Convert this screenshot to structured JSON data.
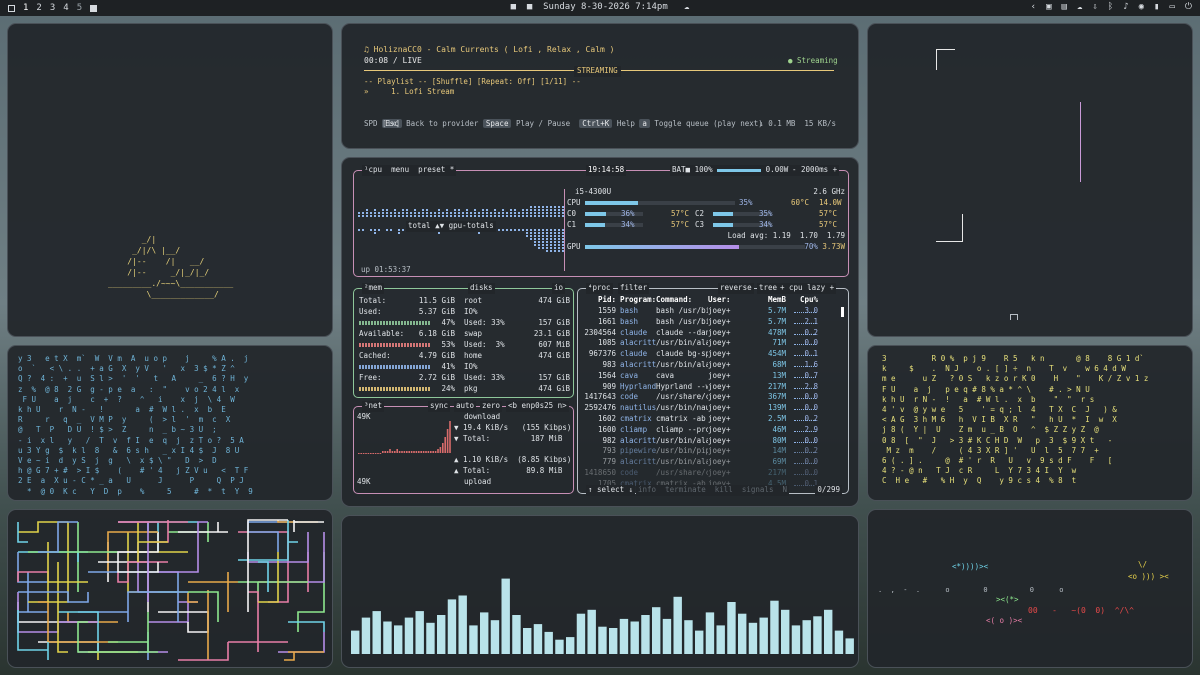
{
  "topbar": {
    "workspaces": [
      "1",
      "2",
      "3",
      "4",
      "5"
    ],
    "datetime": "Sunday 8-30-2026 7:14pm"
  },
  "player": {
    "title": "♫ HoliznaCC0 - Calm Currents ( Lofi , Relax , Calm )",
    "time": "00:08 / LIVE",
    "status_center": "STREAMING",
    "status_right": "● Streaming",
    "playlist_line": "-- Playlist -- [Shuffle] [Repeat: Off] [1/11] --",
    "track": "»     1. Lofi Stream",
    "keys": [
      {
        "key": "Esc",
        "label": "Back to provider"
      },
      {
        "key": "Space",
        "label": "Play / Pause"
      },
      {
        "key": "Ctrl+K",
        "label": "Help"
      },
      {
        "key": "a",
        "label": "Toggle queue (play next)"
      }
    ],
    "spd": "SPD [1x]",
    "transfer": "↓ 0.1 MB  15 KB/s"
  },
  "btop": {
    "cpu_header": "¹cpu  menu  preset *",
    "clock": "19:14:58",
    "bat": "BAT■ 100%",
    "power": "0.00W",
    "interval": "- 2000ms +",
    "total_label": "total ▲▼ gpu-totals",
    "uptime": "up 01:53:37",
    "cpu_model": "i5-4300U",
    "cpu_freq": "2.6 GHz",
    "cpu_rows": [
      {
        "name": "CPU",
        "pct": "35%",
        "temp": "60°C",
        "pwr": "14.0W",
        "fill": 0.35
      },
      {
        "name": "C0",
        "pct": "36%",
        "temp": "57°C",
        "name2": "C2",
        "pct2": "35%",
        "temp2": "57°C",
        "fill": 0.36,
        "fill2": 0.35
      },
      {
        "name": "C1",
        "pct": "34%",
        "temp": "57°C",
        "name2": "C3",
        "pct2": "34%",
        "temp2": "57°C",
        "fill": 0.34,
        "fill2": 0.34
      }
    ],
    "load_avg": "Load avg: 1.19  1.70  1.79",
    "gpu": {
      "name": "GPU",
      "pct": "70%",
      "pwr": "3.73W",
      "fill": 0.7
    },
    "mem": {
      "header": "²mem",
      "rows": [
        {
          "label": "Total:",
          "value": "11.5 GiB"
        },
        {
          "label": "Used:",
          "value": "5.37 GiB"
        },
        {
          "label": "",
          "value": "47%"
        },
        {
          "label": "Available:",
          "value": "6.18 GiB"
        },
        {
          "label": "",
          "value": "53%"
        },
        {
          "label": "Cached:",
          "value": "4.79 GiB"
        },
        {
          "label": "",
          "value": "41%"
        },
        {
          "label": "Free:",
          "value": "2.72 GiB"
        },
        {
          "label": "",
          "value": "24%"
        }
      ]
    },
    "disks": {
      "header": "disks",
      "io": "io",
      "rows": [
        {
          "label": "root",
          "value": "474 GiB"
        },
        {
          "label": "IO%",
          "value": ""
        },
        {
          "label": "Used: 33%",
          "value": "157 GiB"
        },
        {
          "label": "swap",
          "value": "23.1 GiB"
        },
        {
          "label": "Used:  3%",
          "value": "607 MiB"
        },
        {
          "label": "home",
          "value": "474 GiB"
        },
        {
          "label": "IO%",
          "value": ""
        },
        {
          "label": "Used: 33%",
          "value": "157 GiB"
        },
        {
          "label": "pkg",
          "value": "474 GiB"
        }
      ]
    },
    "net": {
      "header": "³net",
      "sync": "sync",
      "auto": "auto",
      "zero": "zero",
      "iface": "<b enp0s25 n>",
      "scale_top": "49K",
      "scale_bot": "49K",
      "download_label": "download",
      "down_rate": "▼ 19.4 KiB/s   (155 Kibps)",
      "down_total": "▼ Total:         187 MiB",
      "up_rate": "▲ 1.10 KiB/s  (8.85 Kibps)",
      "up_total": "▲ Total:        89.8 MiB",
      "upload_label": "upload"
    },
    "proc": {
      "header": "⁴proc",
      "filter": "filter",
      "reverse": "reverse",
      "tree": "tree",
      "mode": "+ cpu lazy +",
      "columns": [
        "Pid:",
        "Program:",
        "Command:",
        "User:",
        "MemB",
        "Cpu%"
      ],
      "rows": [
        [
          "1559",
          "bash",
          "bash /usr/bin/pipe",
          "joey+",
          "5.7M",
          "3.0"
        ],
        [
          "1661",
          "bash",
          "bash /usr/bin/pipe",
          "joey+",
          "5.7M",
          "2.1"
        ],
        [
          "2304564",
          "claude",
          "claude --dangerous",
          "joey+",
          "478M",
          "0.2"
        ],
        [
          "1085",
          "alacritt",
          "/usr/bin/alacritty",
          "joey+",
          "71M",
          "0.0"
        ],
        [
          "967376",
          "claude",
          "claude bg-spare --",
          "joey+",
          "454M",
          "0.1"
        ],
        [
          "983",
          "alacritt",
          "/usr/bin/alacritty",
          "joey+",
          "68M",
          "1.6"
        ],
        [
          "1564",
          "cava",
          "cava",
          "joey+",
          "13M",
          "0.7"
        ],
        [
          "909",
          "Hyprland",
          "Hyprland --watchdo",
          "joey+",
          "217M",
          "2.8"
        ],
        [
          "1417643",
          "code",
          "/usr/share/code/co",
          "joey+",
          "367M",
          "0.0"
        ],
        [
          "2592476",
          "nautilus",
          "/usr/bin/nautilus",
          "joey+",
          "139M",
          "0.0"
        ],
        [
          "1602",
          "cmatrix",
          "cmatrix -ab",
          "joey+",
          "2.5M",
          "0.2"
        ],
        [
          "1600",
          "cliamp",
          "cliamp --provider",
          "joey+",
          "46M",
          "2.9"
        ],
        [
          "982",
          "alacritt",
          "/usr/bin/alacritty",
          "joey+",
          "80M",
          "0.0"
        ],
        [
          "793",
          "pipewire",
          "/usr/bin/pipewire",
          "joey+",
          "14M",
          "0.2"
        ],
        [
          "779",
          "alacritt",
          "/usr/bin/alacritty",
          "joey+",
          "69M",
          "0.0"
        ],
        [
          "1418650",
          "code",
          "/usr/share/code/co",
          "joey+",
          "217M",
          "0.0"
        ],
        [
          "1705",
          "cmatrix",
          "cmatrix -ab -C blu",
          "joey+",
          "4.5M",
          "0.1"
        ]
      ],
      "footer_left": "↑ select ↓",
      "footer_mid": "info  terminate  kill  signals  N",
      "footer_right": "0/299"
    }
  },
  "boat": {
    "art": "       _/|\n     _/|/\\ |__/\n    /|--    /|   __/\n    /|--     _/|_/|_/\n_________./~~~\\___________\n        \\_____________/"
  },
  "pipes_colors": [
    "#e0d24a",
    "#6fd3e8",
    "#b58ee8",
    "#f4f4f4",
    "#7ea7e8",
    "#e87ea7",
    "#8ee88e",
    "#e8a94a"
  ],
  "visualizer": {
    "bar_color": "#b9e3ea",
    "levels": [
      0.18,
      0.28,
      0.33,
      0.25,
      0.22,
      0.28,
      0.33,
      0.24,
      0.3,
      0.42,
      0.45,
      0.22,
      0.32,
      0.26,
      0.58,
      0.3,
      0.2,
      0.23,
      0.17,
      0.11,
      0.13,
      0.31,
      0.34,
      0.21,
      0.2,
      0.27,
      0.25,
      0.3,
      0.36,
      0.27,
      0.44,
      0.26,
      0.18,
      0.32,
      0.22,
      0.4,
      0.31,
      0.24,
      0.28,
      0.41,
      0.34,
      0.22,
      0.26,
      0.29,
      0.34,
      0.18,
      0.12
    ]
  },
  "matrix": {
    "left_text": "y 3   e t X  m`  W  V m  A  u o p    j     % A .  j\no  `   < \\ . .  + a G  X  y V   '   x  3 $ * Z ^\nQ ?  4 :  +  u  S l >  '  '   t   A     _  6 ? H  y\nz  %  @ 8  2 G  g - p e  a   :  \"    v o 2 4 l  x\n F U    a  j    c  +  ?    ^   i    x  j  \\ 4  W\nk h U    r  N -   !       a  #  W l .  x  b  E\nR     r   q  _  V M P  y     (  > l  '  m  c  X\n@   T  P   D U  ! $ >  Z     n  _ b ~ 3 U  ;\n- i  x l   y   /  T  v  f I  e  q  j  z T o ?  5 A\nu 3 Y g  $  k l  8   &  6 s h   _ x I 4 $  J  8 U\nV e ~ i  d  y S  j  g   \\  x $ \\ \"   D  >  D\nh @ G 7 + #  > I $    (    # ' 4   j Z V u   <  T F\n2 E  a  X u - C * _ a   U      J      P     Q  P J\n  *  @ 0  K c   Y  D  p    %     5     #  *  t  Y  9",
    "right_text": "3          R 0 %  p j 9    R 5   k n       @ 8    8 G 1 d`\nk     $    .  N J    o . [ ] ÷  n    T  v    w 6 4 d W\nm e      u Z   ? 0 S   k z o r K 0    H    \"    K / Z v 1 z\nF U    a  j   p e q # 8 % a * ^ \\    # . > N U\nk h U  r N -  !   a  # W l .  x  b    \"  \"  r s\n4 ' v  @ y w e   5    ' = q ; l  4   T X  C  J   ) &\n< A G  3 h M 6   h  V I B  X R   \"   h U  *  I  w  X\nj 8 (  Y |  U    Z m  u _ B  O   ^  $ Z Z y Z  @\n0 8  [  \"  J   > 3 # K C H D  W   p  3  $ 9 X t   -\n M z  m    /     ( 4 3 X R ] '   U  l  5  7 7  +\n6 ( . ] .     @  # ' r  R   U   v  9 s d F    F   [\n4 ? - @ n   T J  c R     L  Y 7 3 4 I  Y  w\nC  H e   #   % H  y  Q    y 9 c s 4  % 8  t"
  },
  "aquarium": {
    "fish": "<*))))><",
    "fish2": "><(*>",
    "fish3": "<o ))) ><",
    "fish4": "<( o )><",
    "plant": "\\/"
  }
}
